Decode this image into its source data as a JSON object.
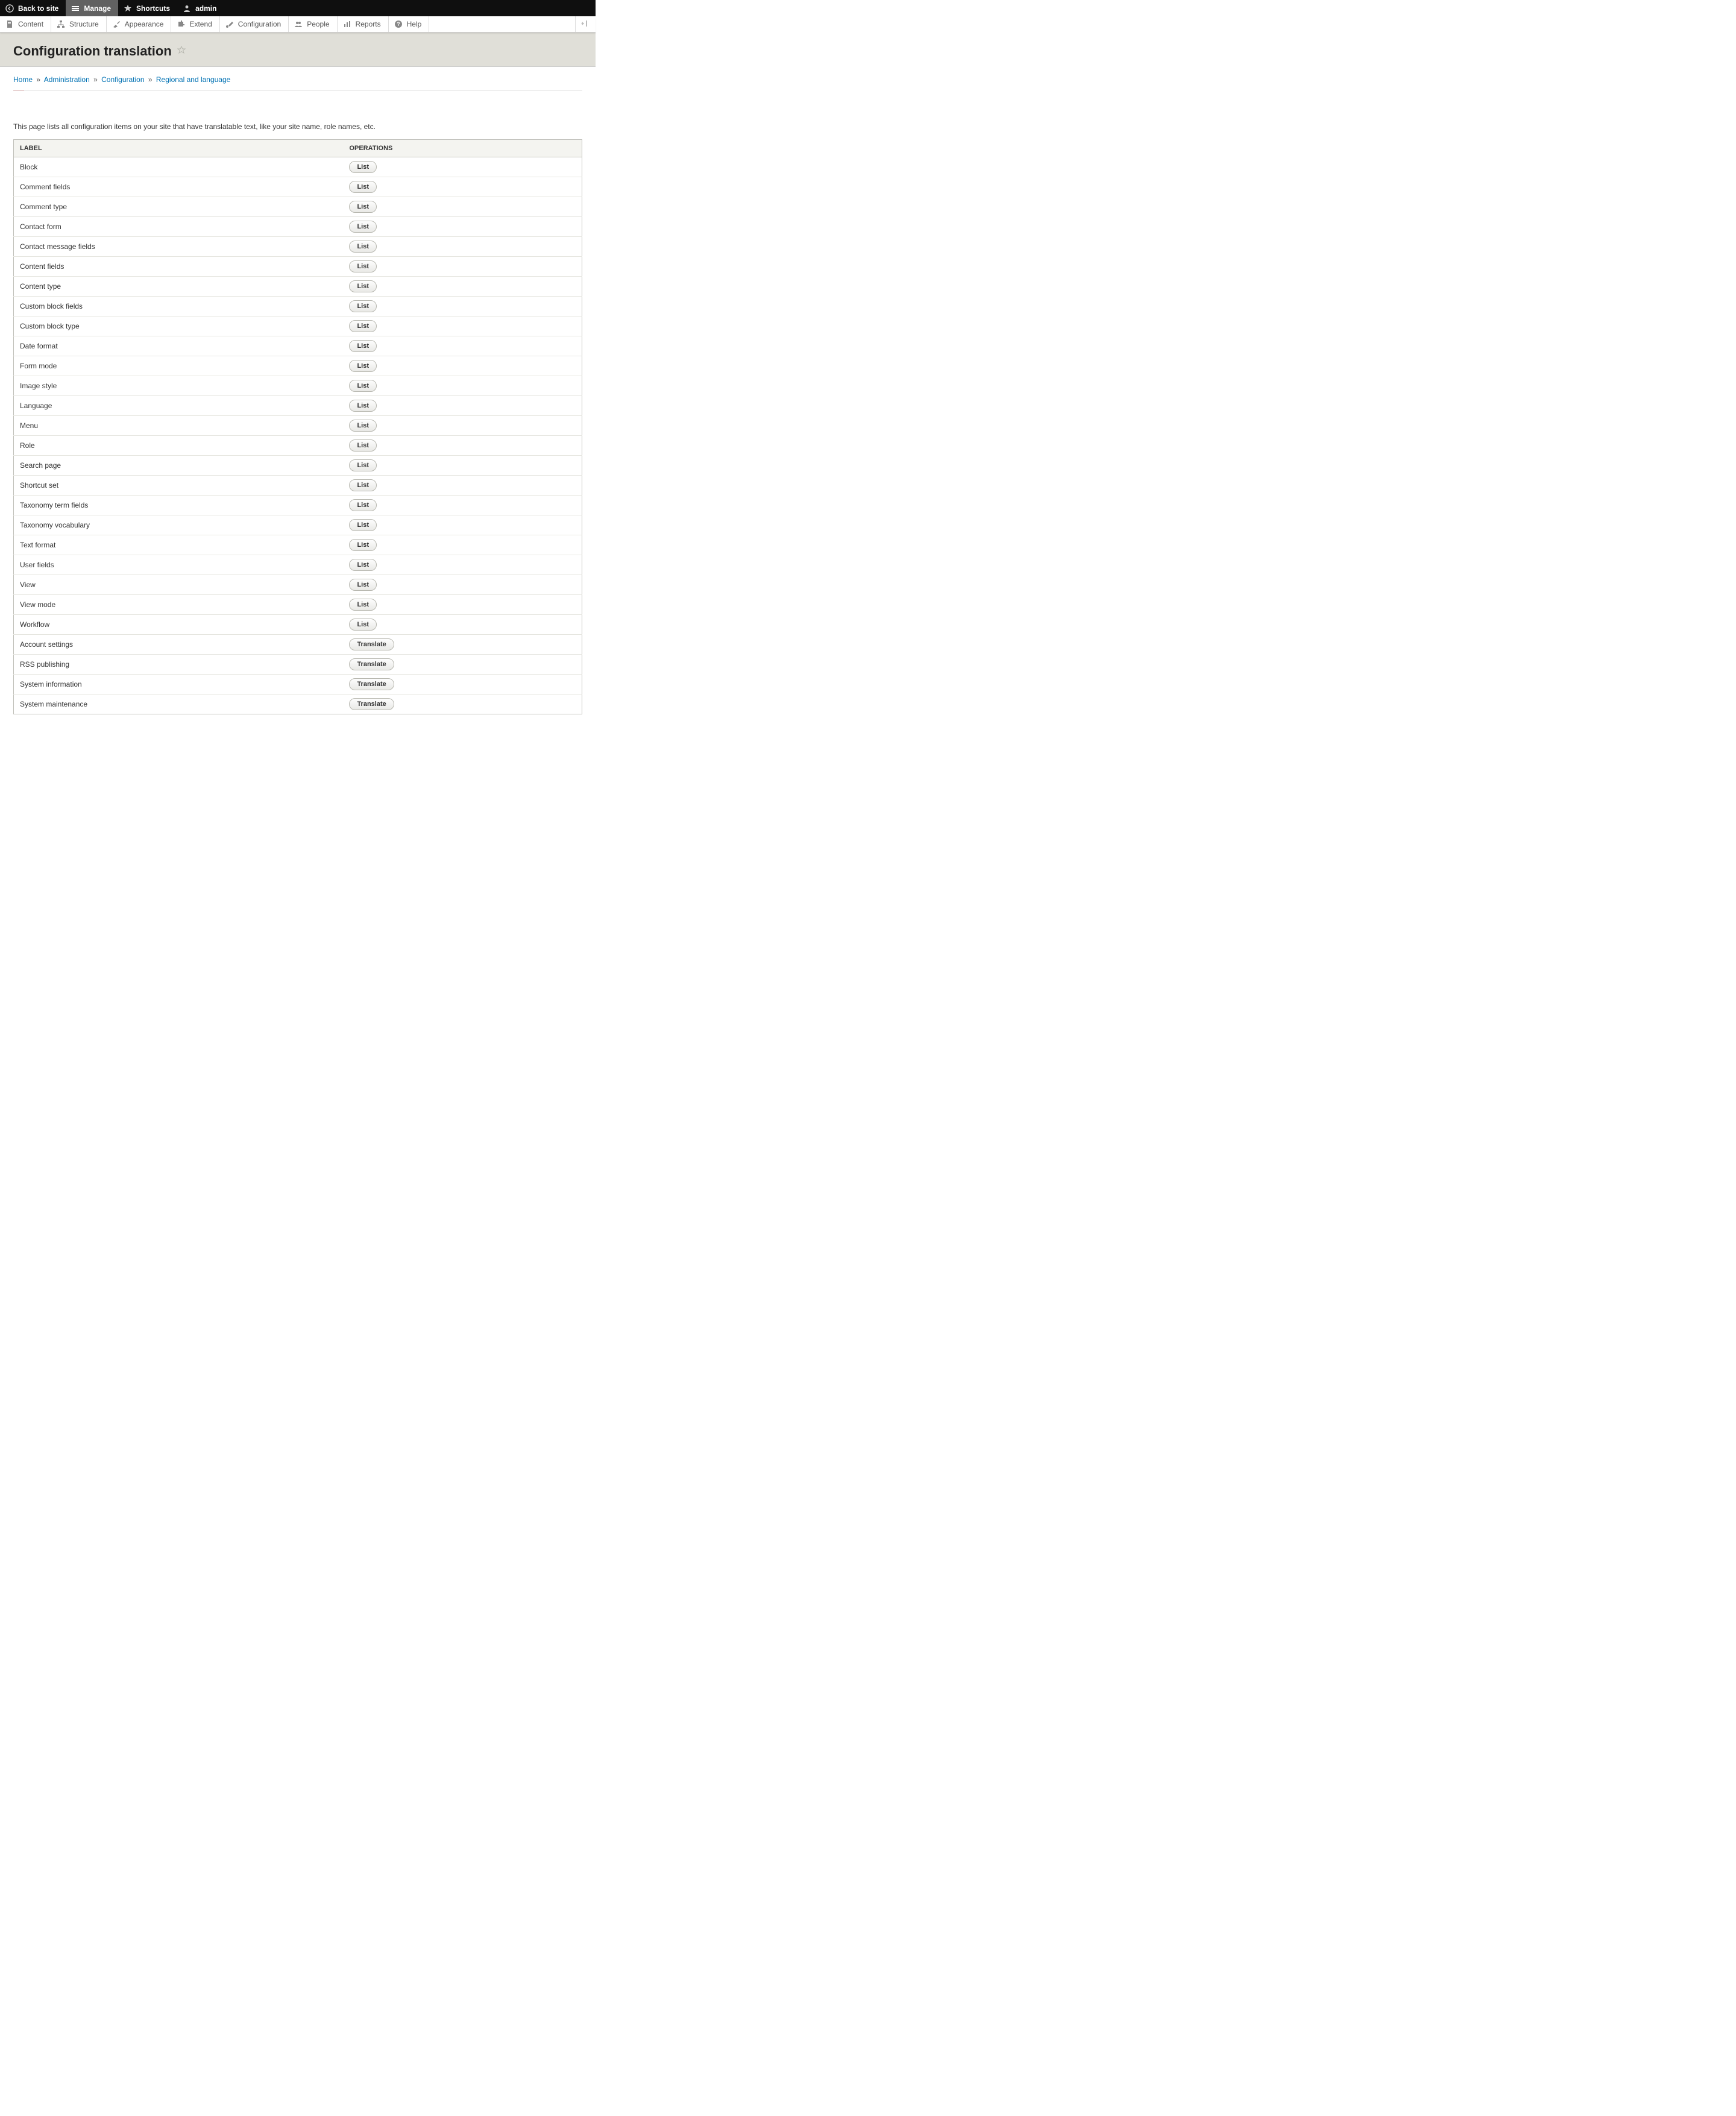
{
  "toolbar_bar": {
    "back": "Back to site",
    "manage": "Manage",
    "shortcuts": "Shortcuts",
    "user": "admin"
  },
  "toolbar_tray": {
    "items": [
      {
        "label": "Content"
      },
      {
        "label": "Structure"
      },
      {
        "label": "Appearance"
      },
      {
        "label": "Extend"
      },
      {
        "label": "Configuration"
      },
      {
        "label": "People"
      },
      {
        "label": "Reports"
      },
      {
        "label": "Help"
      }
    ]
  },
  "page": {
    "title": "Configuration translation",
    "intro": "This page lists all configuration items on your site that have translatable text, like your site name, role names, etc."
  },
  "breadcrumb": {
    "items": [
      {
        "label": "Home"
      },
      {
        "label": "Administration"
      },
      {
        "label": "Configuration"
      },
      {
        "label": "Regional and language"
      }
    ],
    "separator": "»"
  },
  "table": {
    "headers": {
      "label": "LABEL",
      "operations": "OPERATIONS"
    },
    "rows": [
      {
        "label": "Block",
        "op": "List"
      },
      {
        "label": "Comment fields",
        "op": "List"
      },
      {
        "label": "Comment type",
        "op": "List"
      },
      {
        "label": "Contact form",
        "op": "List"
      },
      {
        "label": "Contact message fields",
        "op": "List"
      },
      {
        "label": "Content fields",
        "op": "List"
      },
      {
        "label": "Content type",
        "op": "List"
      },
      {
        "label": "Custom block fields",
        "op": "List"
      },
      {
        "label": "Custom block type",
        "op": "List"
      },
      {
        "label": "Date format",
        "op": "List"
      },
      {
        "label": "Form mode",
        "op": "List"
      },
      {
        "label": "Image style",
        "op": "List"
      },
      {
        "label": "Language",
        "op": "List"
      },
      {
        "label": "Menu",
        "op": "List"
      },
      {
        "label": "Role",
        "op": "List"
      },
      {
        "label": "Search page",
        "op": "List"
      },
      {
        "label": "Shortcut set",
        "op": "List"
      },
      {
        "label": "Taxonomy term fields",
        "op": "List"
      },
      {
        "label": "Taxonomy vocabulary",
        "op": "List"
      },
      {
        "label": "Text format",
        "op": "List"
      },
      {
        "label": "User fields",
        "op": "List"
      },
      {
        "label": "View",
        "op": "List"
      },
      {
        "label": "View mode",
        "op": "List"
      },
      {
        "label": "Workflow",
        "op": "List"
      },
      {
        "label": "Account settings",
        "op": "Translate"
      },
      {
        "label": "RSS publishing",
        "op": "Translate"
      },
      {
        "label": "System information",
        "op": "Translate"
      },
      {
        "label": "System maintenance",
        "op": "Translate"
      }
    ]
  }
}
